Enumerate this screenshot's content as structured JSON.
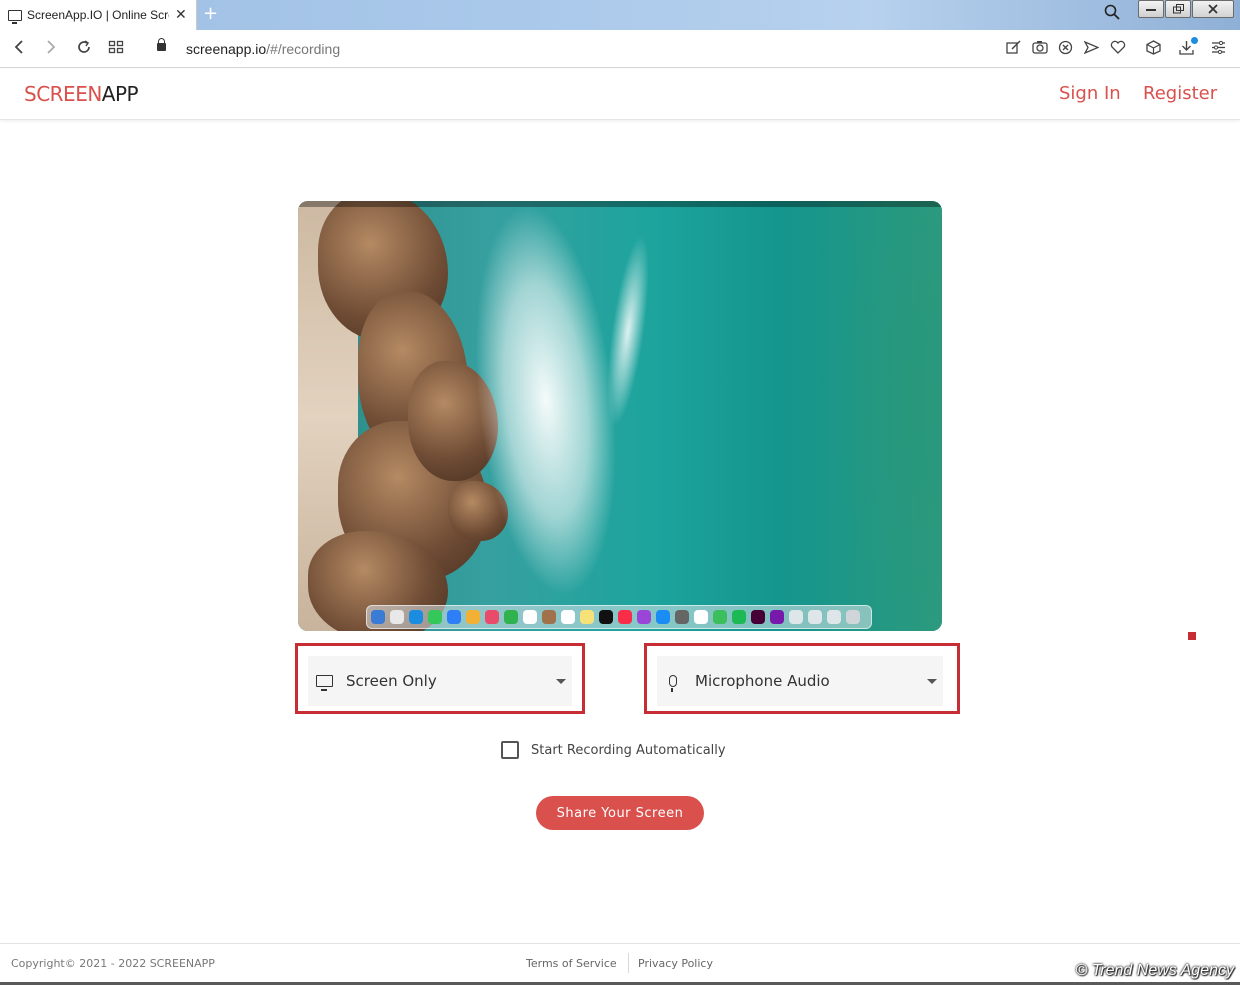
{
  "browser": {
    "tab_title": "ScreenApp.IO | Online Scre",
    "tab_close": "✕",
    "new_tab": "+",
    "url_host": "screenapp.io",
    "url_path": "/#/recording"
  },
  "header": {
    "logo_part1": "SCREEN",
    "logo_part2": "APP",
    "sign_in": "Sign In",
    "register": "Register"
  },
  "controls": {
    "video_source": {
      "selected": "Screen Only",
      "icon": "monitor-icon"
    },
    "audio_source": {
      "selected": "Microphone Audio",
      "icon": "microphone-icon"
    },
    "auto_start_label": "Start Recording Automatically",
    "auto_start_checked": false,
    "share_button": "Share Your Screen"
  },
  "colors": {
    "brand": "#d9504c",
    "highlight": "#c62d34"
  },
  "footer": {
    "copyright": "Copyright©   2021 - 2022 SCREENAPP",
    "terms": "Terms of Service",
    "privacy": "Privacy Policy"
  },
  "watermark": "© Trend News Agency"
}
